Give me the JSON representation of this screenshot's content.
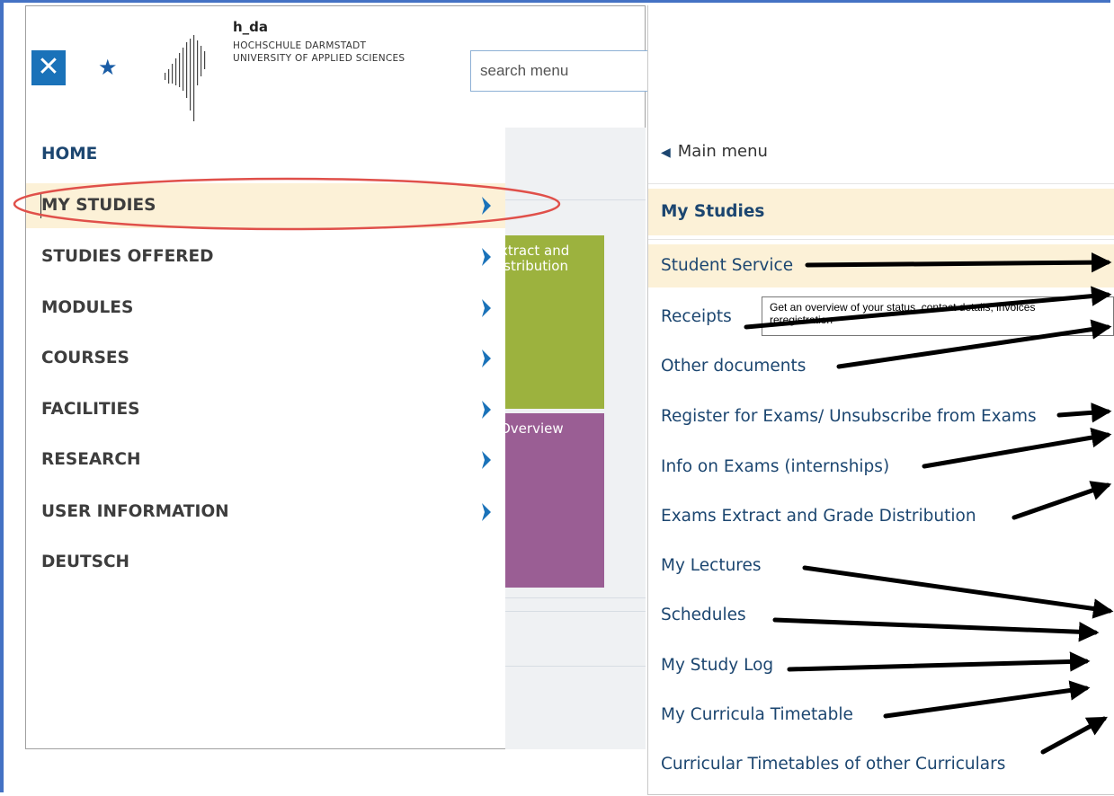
{
  "logo": {
    "title": "h_da",
    "line1": "HOCHSCHULE DARMSTADT",
    "line2": "UNIVERSITY OF APPLIED SCIENCES"
  },
  "toolbar": {
    "close_symbol": "✕",
    "favorite_symbol": "★",
    "search_placeholder": "search menu"
  },
  "main_nav": {
    "items": [
      {
        "label": "HOME",
        "has_submenu": false
      },
      {
        "label": "MY STUDIES",
        "has_submenu": true,
        "selected": true
      },
      {
        "label": "STUDIES OFFERED",
        "has_submenu": true
      },
      {
        "label": "MODULES",
        "has_submenu": true
      },
      {
        "label": "COURSES",
        "has_submenu": true
      },
      {
        "label": "FACILITIES",
        "has_submenu": true
      },
      {
        "label": "RESEARCH",
        "has_submenu": true
      },
      {
        "label": "USER INFORMATION",
        "has_submenu": true
      },
      {
        "label": "DEUTSCH",
        "has_submenu": false
      }
    ]
  },
  "background_tiles": {
    "green_line1": "xtract and",
    "green_line2": "istribution",
    "purple_line1": "Overview"
  },
  "submenu": {
    "back_label": "Main menu",
    "title": "My Studies",
    "items": [
      "Student Service",
      "Receipts",
      "Other documents",
      "Register for Exams/ Unsubscribe from Exams",
      "Info on Exams (internships)",
      "Exams Extract and Grade Distribution",
      "My Lectures",
      "Schedules",
      "My Study Log",
      "My Curricula Timetable",
      "Curricular Timetables of other Curriculars"
    ]
  },
  "tooltip": {
    "line1": "Get an overview of your status, contact details, invoices",
    "line2": "reregistration"
  },
  "colors": {
    "brand_blue": "#1a72b9",
    "nav_text": "#3d3d3d",
    "link_blue": "#1c4670",
    "highlight_bg": "#fcf1d7",
    "annotation_red": "#e0504a",
    "tile_green": "#9cb23e",
    "tile_purple": "#9a5e94"
  }
}
